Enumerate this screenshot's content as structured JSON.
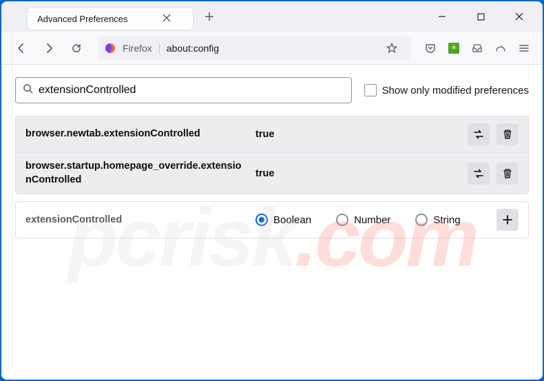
{
  "tab": {
    "title": "Advanced Preferences"
  },
  "urlbar": {
    "identity": "Firefox",
    "url": "about:config"
  },
  "search": {
    "value": "extensionControlled",
    "checkbox_label": "Show only modified preferences"
  },
  "prefs": [
    {
      "name": "browser.newtab.extensionControlled",
      "value": "true"
    },
    {
      "name": "browser.startup.homepage_override.extensionControlled",
      "value": "true"
    }
  ],
  "newpref": {
    "name": "extensionControlled",
    "types": {
      "boolean": "Boolean",
      "number": "Number",
      "string": "String"
    }
  },
  "watermark": {
    "brand": "pcrisk",
    "tld": ".com"
  }
}
